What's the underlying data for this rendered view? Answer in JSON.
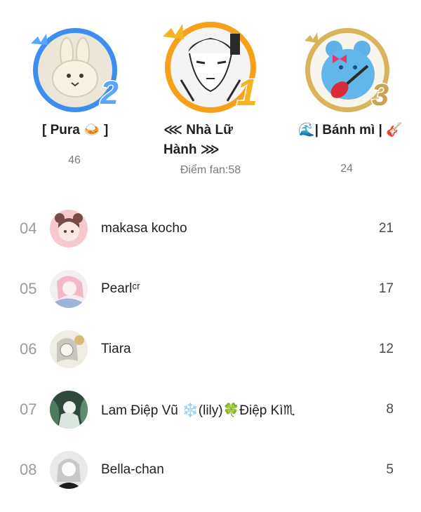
{
  "podium": [
    {
      "rank": 2,
      "rank_label": "2",
      "name": "[ Pura 🍛 ]",
      "score": "46",
      "ring_color": "#3d8ef0",
      "badge_color": "#5aa6ff"
    },
    {
      "rank": 1,
      "rank_label": "1",
      "name": "⋘ Nhà Lữ Hành ⋙",
      "score": "Điểm fan:58",
      "ring_color": "#f7a11a",
      "badge_color": "#f6b322"
    },
    {
      "rank": 3,
      "rank_label": "3",
      "name": "🌊| Bánh mì | 🎸",
      "score": "24",
      "ring_color": "#d9b45c",
      "badge_color": "#caa352"
    }
  ],
  "list": [
    {
      "rank": "04",
      "name": "makasa kocho",
      "points": "21",
      "avatar_color": "#f6c9cf"
    },
    {
      "rank": "05",
      "name": "Pearlᶜʳ",
      "points": "17",
      "avatar_color": "#e9d2dc"
    },
    {
      "rank": "06",
      "name": "Tiara",
      "points": "12",
      "avatar_color": "#e6e3d6"
    },
    {
      "rank": "07",
      "name": "Lam Điệp Vũ ❄️(lily)🍀Điệp Kì♏",
      "points": "8",
      "avatar_color": "#4e6a5a"
    },
    {
      "rank": "08",
      "name": "Bella-chan",
      "points": "5",
      "avatar_color": "#d8d8d8"
    }
  ]
}
